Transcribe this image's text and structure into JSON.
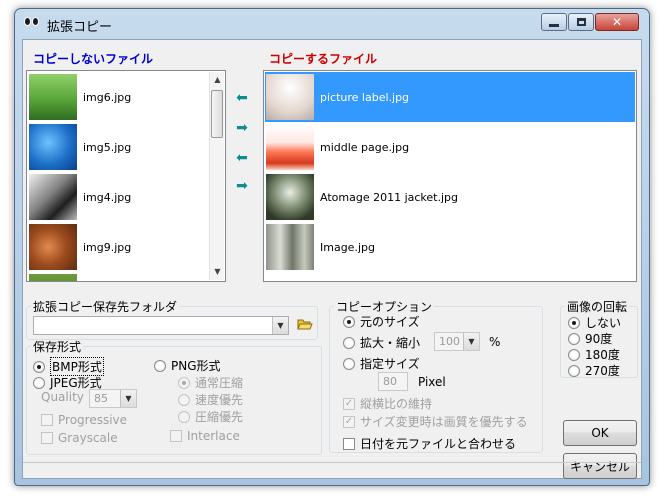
{
  "window": {
    "title": "拡張コピー",
    "min_label": "minimize",
    "max_label": "maximize",
    "close_label": "x"
  },
  "left_panel": {
    "header": "コピーしないファイル",
    "header_color": "#0000cc",
    "files": [
      {
        "name": "img6.jpg",
        "thumb": "green-field"
      },
      {
        "name": "img5.jpg",
        "thumb": "blue-water"
      },
      {
        "name": "img4.jpg",
        "thumb": "monochrome-rocks"
      },
      {
        "name": "img9.jpg",
        "thumb": "brown-wood"
      },
      {
        "name": "",
        "thumb": "green-grass"
      }
    ]
  },
  "right_panel": {
    "header": "コピーするファイル",
    "header_color": "#cc0000",
    "selection_color": "#3399ff",
    "files": [
      {
        "name": "picture label.jpg",
        "thumb": "pale-light",
        "selected": true
      },
      {
        "name": "middle page.jpg",
        "thumb": "red-sunset",
        "selected": false
      },
      {
        "name": "Atomage 2011 jacket.jpg",
        "thumb": "forest-dark",
        "selected": false
      },
      {
        "name": "Image.jpg",
        "thumb": "frost-trees",
        "selected": false
      }
    ]
  },
  "transfer_buttons": {
    "move_left_icon": "arrow-left-icon",
    "move_right_icon": "arrow-right-icon",
    "move_all_left_icon": "arrow-left-all-icon",
    "move_all_right_icon": "arrow-right-all-icon"
  },
  "dest_folder": {
    "legend": "拡張コピー保存先フォルダ",
    "value": "",
    "browse_icon": "folder-open-icon"
  },
  "save_format": {
    "legend": "保存形式",
    "bmp_label": "BMP形式",
    "jpeg_label": "JPEG形式",
    "png_label": "PNG形式",
    "selected": "BMP形式",
    "quality_label": "Quality",
    "quality_value": "85",
    "progressive_label": "Progressive",
    "grayscale_label": "Grayscale",
    "png_normal_label": "通常圧縮",
    "png_speed_label": "速度優先",
    "png_comp_label": "圧縮優先",
    "interlace_label": "Interlace"
  },
  "copy_options": {
    "legend": "コピーオプション",
    "original_label": "元のサイズ",
    "scale_label": "拡大・縮小",
    "scale_value": "100",
    "percent_label": "%",
    "specified_label": "指定サイズ",
    "pixel_value": "80",
    "pixel_label": "Pixel",
    "keep_ratio_label": "縦横比の維持",
    "quality_priority_label": "サイズ変更時は画質を優先する",
    "match_date_label": "日付を元ファイルと合わせる"
  },
  "rotation": {
    "legend": "画像の回転",
    "none_label": "しない",
    "r90_label": "90度",
    "r180_label": "180度",
    "r270_label": "270度"
  },
  "buttons": {
    "ok_label": "OK",
    "cancel_label": "キャンセル"
  }
}
